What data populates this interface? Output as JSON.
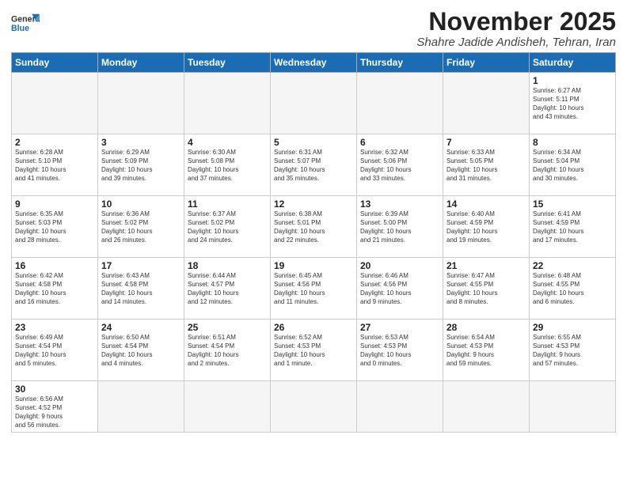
{
  "header": {
    "logo_general": "General",
    "logo_blue": "Blue",
    "month_title": "November 2025",
    "location": "Shahre Jadide Andisheh, Tehran, Iran"
  },
  "weekdays": [
    "Sunday",
    "Monday",
    "Tuesday",
    "Wednesday",
    "Thursday",
    "Friday",
    "Saturday"
  ],
  "weeks": [
    [
      {
        "day": "",
        "info": "",
        "empty": true
      },
      {
        "day": "",
        "info": "",
        "empty": true
      },
      {
        "day": "",
        "info": "",
        "empty": true
      },
      {
        "day": "",
        "info": "",
        "empty": true
      },
      {
        "day": "",
        "info": "",
        "empty": true
      },
      {
        "day": "",
        "info": "",
        "empty": true
      },
      {
        "day": "1",
        "info": "Sunrise: 6:27 AM\nSunset: 5:11 PM\nDaylight: 10 hours\nand 43 minutes."
      }
    ],
    [
      {
        "day": "2",
        "info": "Sunrise: 6:28 AM\nSunset: 5:10 PM\nDaylight: 10 hours\nand 41 minutes."
      },
      {
        "day": "3",
        "info": "Sunrise: 6:29 AM\nSunset: 5:09 PM\nDaylight: 10 hours\nand 39 minutes."
      },
      {
        "day": "4",
        "info": "Sunrise: 6:30 AM\nSunset: 5:08 PM\nDaylight: 10 hours\nand 37 minutes."
      },
      {
        "day": "5",
        "info": "Sunrise: 6:31 AM\nSunset: 5:07 PM\nDaylight: 10 hours\nand 35 minutes."
      },
      {
        "day": "6",
        "info": "Sunrise: 6:32 AM\nSunset: 5:06 PM\nDaylight: 10 hours\nand 33 minutes."
      },
      {
        "day": "7",
        "info": "Sunrise: 6:33 AM\nSunset: 5:05 PM\nDaylight: 10 hours\nand 31 minutes."
      },
      {
        "day": "8",
        "info": "Sunrise: 6:34 AM\nSunset: 5:04 PM\nDaylight: 10 hours\nand 30 minutes."
      }
    ],
    [
      {
        "day": "9",
        "info": "Sunrise: 6:35 AM\nSunset: 5:03 PM\nDaylight: 10 hours\nand 28 minutes."
      },
      {
        "day": "10",
        "info": "Sunrise: 6:36 AM\nSunset: 5:02 PM\nDaylight: 10 hours\nand 26 minutes."
      },
      {
        "day": "11",
        "info": "Sunrise: 6:37 AM\nSunset: 5:02 PM\nDaylight: 10 hours\nand 24 minutes."
      },
      {
        "day": "12",
        "info": "Sunrise: 6:38 AM\nSunset: 5:01 PM\nDaylight: 10 hours\nand 22 minutes."
      },
      {
        "day": "13",
        "info": "Sunrise: 6:39 AM\nSunset: 5:00 PM\nDaylight: 10 hours\nand 21 minutes."
      },
      {
        "day": "14",
        "info": "Sunrise: 6:40 AM\nSunset: 4:59 PM\nDaylight: 10 hours\nand 19 minutes."
      },
      {
        "day": "15",
        "info": "Sunrise: 6:41 AM\nSunset: 4:59 PM\nDaylight: 10 hours\nand 17 minutes."
      }
    ],
    [
      {
        "day": "16",
        "info": "Sunrise: 6:42 AM\nSunset: 4:58 PM\nDaylight: 10 hours\nand 16 minutes."
      },
      {
        "day": "17",
        "info": "Sunrise: 6:43 AM\nSunset: 4:58 PM\nDaylight: 10 hours\nand 14 minutes."
      },
      {
        "day": "18",
        "info": "Sunrise: 6:44 AM\nSunset: 4:57 PM\nDaylight: 10 hours\nand 12 minutes."
      },
      {
        "day": "19",
        "info": "Sunrise: 6:45 AM\nSunset: 4:56 PM\nDaylight: 10 hours\nand 11 minutes."
      },
      {
        "day": "20",
        "info": "Sunrise: 6:46 AM\nSunset: 4:56 PM\nDaylight: 10 hours\nand 9 minutes."
      },
      {
        "day": "21",
        "info": "Sunrise: 6:47 AM\nSunset: 4:55 PM\nDaylight: 10 hours\nand 8 minutes."
      },
      {
        "day": "22",
        "info": "Sunrise: 6:48 AM\nSunset: 4:55 PM\nDaylight: 10 hours\nand 6 minutes."
      }
    ],
    [
      {
        "day": "23",
        "info": "Sunrise: 6:49 AM\nSunset: 4:54 PM\nDaylight: 10 hours\nand 5 minutes."
      },
      {
        "day": "24",
        "info": "Sunrise: 6:50 AM\nSunset: 4:54 PM\nDaylight: 10 hours\nand 4 minutes."
      },
      {
        "day": "25",
        "info": "Sunrise: 6:51 AM\nSunset: 4:54 PM\nDaylight: 10 hours\nand 2 minutes."
      },
      {
        "day": "26",
        "info": "Sunrise: 6:52 AM\nSunset: 4:53 PM\nDaylight: 10 hours\nand 1 minute."
      },
      {
        "day": "27",
        "info": "Sunrise: 6:53 AM\nSunset: 4:53 PM\nDaylight: 10 hours\nand 0 minutes."
      },
      {
        "day": "28",
        "info": "Sunrise: 6:54 AM\nSunset: 4:53 PM\nDaylight: 9 hours\nand 59 minutes."
      },
      {
        "day": "29",
        "info": "Sunrise: 6:55 AM\nSunset: 4:53 PM\nDaylight: 9 hours\nand 57 minutes."
      }
    ],
    [
      {
        "day": "30",
        "info": "Sunrise: 6:56 AM\nSunset: 4:52 PM\nDaylight: 9 hours\nand 56 minutes.",
        "lastrow": true
      },
      {
        "day": "",
        "info": "",
        "empty": true,
        "lastrow": true
      },
      {
        "day": "",
        "info": "",
        "empty": true,
        "lastrow": true
      },
      {
        "day": "",
        "info": "",
        "empty": true,
        "lastrow": true
      },
      {
        "day": "",
        "info": "",
        "empty": true,
        "lastrow": true
      },
      {
        "day": "",
        "info": "",
        "empty": true,
        "lastrow": true
      },
      {
        "day": "",
        "info": "",
        "empty": true,
        "lastrow": true
      }
    ]
  ]
}
